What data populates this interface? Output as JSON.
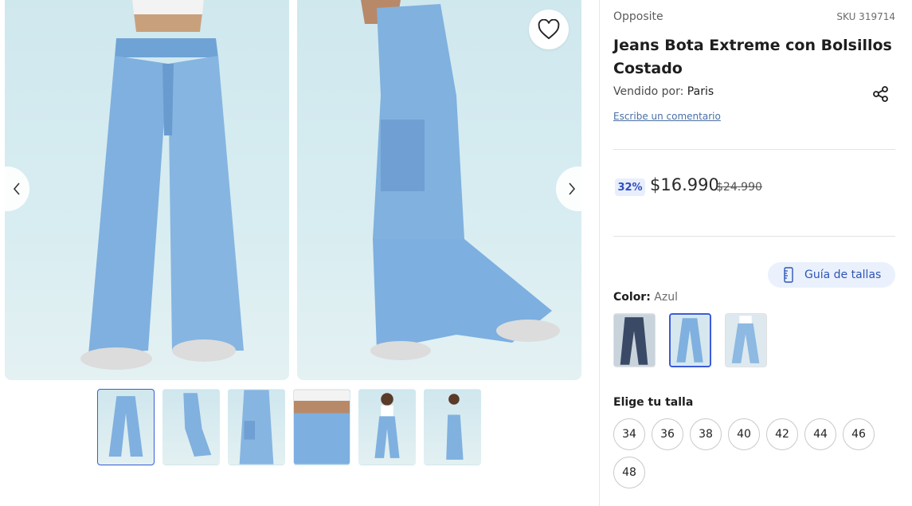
{
  "product": {
    "brand": "Opposite",
    "sku": "SKU 319714",
    "title": "Jeans Bota Extreme con Bolsillos Costado",
    "seller_prefix": "Vendido por:",
    "seller_name": "Paris",
    "review_link": "Escribe un comentario"
  },
  "pricing": {
    "discount": "32%",
    "price": "$16.990",
    "old_price": "$24.990"
  },
  "size_guide": {
    "label": "Guía de tallas"
  },
  "color": {
    "label": "Color:",
    "value": "Azul",
    "swatches": [
      "dark-denim",
      "light-denim",
      "light-denim-alt"
    ]
  },
  "sizes": {
    "label": "Elige tu talla",
    "options": [
      "34",
      "36",
      "38",
      "40",
      "42",
      "44",
      "46",
      "48"
    ]
  },
  "gallery": {
    "thumbnail_count": 6,
    "active_thumbnail": 1
  },
  "colors": {
    "accent": "#3b5bdb",
    "denim": "#7faedb",
    "discount_bg": "#e8eefc"
  },
  "icons": [
    "heart-icon",
    "chevron-left-icon",
    "chevron-right-icon",
    "share-icon",
    "ruler-icon"
  ]
}
